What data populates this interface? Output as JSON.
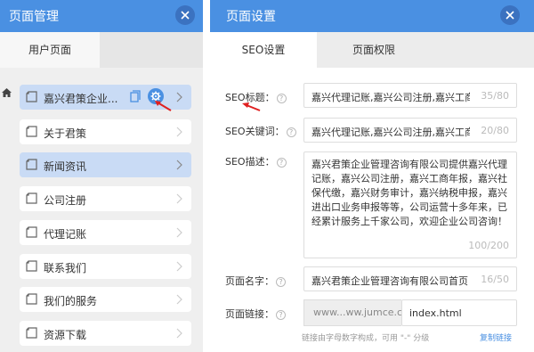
{
  "left": {
    "title": "页面管理",
    "tab": "用户页面",
    "items": [
      {
        "label": "嘉兴君策企业..."
      },
      {
        "label": "关于君策"
      },
      {
        "label": "新闻资讯"
      },
      {
        "label": "公司注册"
      },
      {
        "label": "代理记账"
      },
      {
        "label": "联系我们"
      },
      {
        "label": "我们的服务"
      },
      {
        "label": "资源下载"
      }
    ]
  },
  "right": {
    "title": "页面设置",
    "tabs": [
      "SEO设置",
      "页面权限"
    ],
    "fields": {
      "seo_title": {
        "label": "SEO标题",
        "value": "嘉兴代理记账,嘉兴公司注册,嘉兴工商代理",
        "count": "35/80"
      },
      "seo_keywords": {
        "label": "SEO关键词",
        "value": "嘉兴代理记账,嘉兴公司注册,嘉兴工商代理",
        "count": "20/80"
      },
      "seo_desc": {
        "label": "SEO描述",
        "value": "嘉兴君策企业管理咨询有限公司提供嘉兴代理记账，嘉兴公司注册，嘉兴工商年报，嘉兴社保代缴，嘉兴财务审计，嘉兴纳税申报，嘉兴进出口业务申报等等，公司运营十多年来，已经累计服务上千家公司，欢迎企业公司咨询！",
        "count": "100/200"
      },
      "page_name": {
        "label": "页面名字",
        "value": "嘉兴君策企业管理咨询有限公司首页",
        "count": "16/50"
      },
      "page_link": {
        "label": "页面链接",
        "prefix": "www...ww.jumce.co",
        "value": "index.html"
      }
    },
    "hint": "链接由字母数字构成，可用 \"-\" 分级",
    "copy_link": "复制链接",
    "colon": "："
  },
  "colors": {
    "accent": "#4a90e2",
    "selected": "#c9dbf5"
  }
}
